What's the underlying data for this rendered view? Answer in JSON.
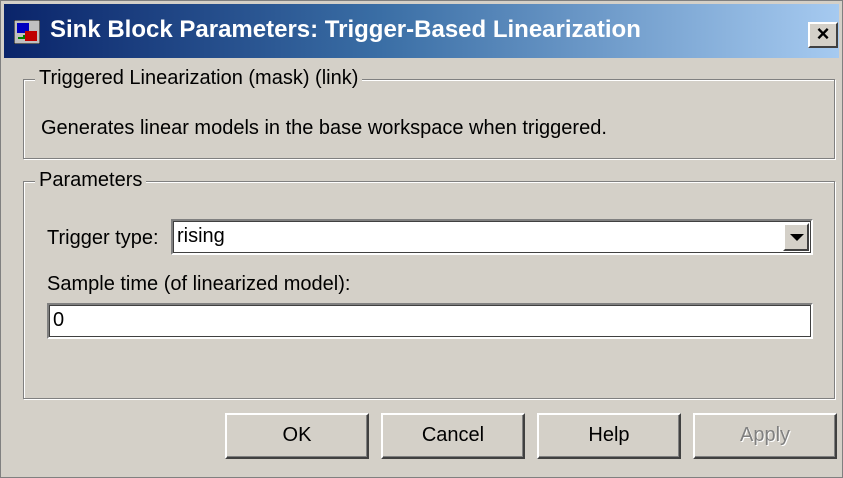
{
  "window": {
    "title": "Sink Block Parameters: Trigger-Based Linearization",
    "close_glyph": "×"
  },
  "description_group": {
    "legend": "Triggered Linearization (mask) (link)",
    "text": "Generates linear models in the base workspace when triggered."
  },
  "parameters_group": {
    "legend": "Parameters",
    "trigger_type": {
      "label": "Trigger type:",
      "value": "rising"
    },
    "sample_time": {
      "label": "Sample time (of linearized model):",
      "value": "0"
    }
  },
  "buttons": {
    "ok": "OK",
    "cancel": "Cancel",
    "help": "Help",
    "apply": "Apply"
  },
  "icons": {
    "app": "simulink-block-icon",
    "close": "close-icon",
    "dropdown": "chevron-down-icon"
  },
  "colors": {
    "titlebar_start": "#0a246a",
    "titlebar_end": "#a6caf0",
    "face": "#d4d0c8"
  }
}
